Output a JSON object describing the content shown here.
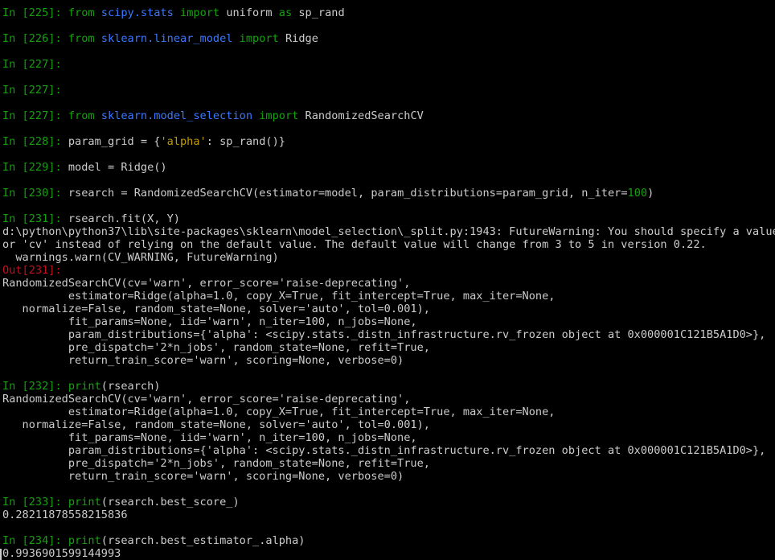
{
  "colors": {
    "background": "#000000",
    "text": "#cccccc",
    "prompt": "#13a10e",
    "module": "#3b78ff",
    "string": "#c19c00",
    "out_prompt": "#c50f1f"
  },
  "cells": {
    "c225": {
      "prompt": "In [225]:",
      "kw_from": "from",
      "module": "scipy.stats",
      "kw_import": "import",
      "name": "uniform",
      "kw_as": "as",
      "alias": "sp_rand"
    },
    "c226": {
      "prompt": "In [226]:",
      "kw_from": "from",
      "module": "sklearn.linear_model",
      "kw_import": "import",
      "name": "Ridge"
    },
    "c227a": {
      "prompt": "In [227]:"
    },
    "c227b": {
      "prompt": "In [227]:"
    },
    "c227c": {
      "prompt": "In [227]:",
      "kw_from": "from",
      "module": "sklearn.model_selection",
      "kw_import": "import",
      "name": "RandomizedSearchCV"
    },
    "c228": {
      "prompt": "In [228]:",
      "pre": "param_grid = {",
      "str": "'alpha'",
      "post": ": sp_rand()}"
    },
    "c229": {
      "prompt": "In [229]:",
      "code": "model = Ridge()"
    },
    "c230": {
      "prompt": "In [230]:",
      "pre": "rsearch = RandomizedSearchCV(estimator=model, param_distributions=param_grid, n_iter=",
      "num": "100",
      "post": ")"
    },
    "c231": {
      "prompt": "In [231]:",
      "code": "rsearch.fit(X, Y)",
      "warning": [
        "d:\\python\\python37\\lib\\site-packages\\sklearn\\model_selection\\_split.py:1943: FutureWarning: You should specify a value f",
        "or 'cv' instead of relying on the default value. The default value will change from 3 to 5 in version 0.22.",
        "  warnings.warn(CV_WARNING, FutureWarning)"
      ],
      "out_prompt": "Out[231]:",
      "output": [
        "RandomizedSearchCV(cv='warn', error_score='raise-deprecating',",
        "          estimator=Ridge(alpha=1.0, copy_X=True, fit_intercept=True, max_iter=None,",
        "   normalize=False, random_state=None, solver='auto', tol=0.001),",
        "          fit_params=None, iid='warn', n_iter=100, n_jobs=None,",
        "          param_distributions={'alpha': <scipy.stats._distn_infrastructure.rv_frozen object at 0x000001C121B5A1D0>},",
        "          pre_dispatch='2*n_jobs', random_state=None, refit=True,",
        "          return_train_score='warn', scoring=None, verbose=0)"
      ]
    },
    "c232": {
      "prompt": "In [232]:",
      "fn": "print",
      "args": "(rsearch)",
      "output": [
        "RandomizedSearchCV(cv='warn', error_score='raise-deprecating',",
        "          estimator=Ridge(alpha=1.0, copy_X=True, fit_intercept=True, max_iter=None,",
        "   normalize=False, random_state=None, solver='auto', tol=0.001),",
        "          fit_params=None, iid='warn', n_iter=100, n_jobs=None,",
        "          param_distributions={'alpha': <scipy.stats._distn_infrastructure.rv_frozen object at 0x000001C121B5A1D0>},",
        "          pre_dispatch='2*n_jobs', random_state=None, refit=True,",
        "          return_train_score='warn', scoring=None, verbose=0)"
      ]
    },
    "c233": {
      "prompt": "In [233]:",
      "fn": "print",
      "args": "(rsearch.best_score_)",
      "output": "0.28211878558215836"
    },
    "c234": {
      "prompt": "In [234]:",
      "fn": "print",
      "args": "(rsearch.best_estimator_.alpha)",
      "output": "0.9936901599144993"
    }
  }
}
